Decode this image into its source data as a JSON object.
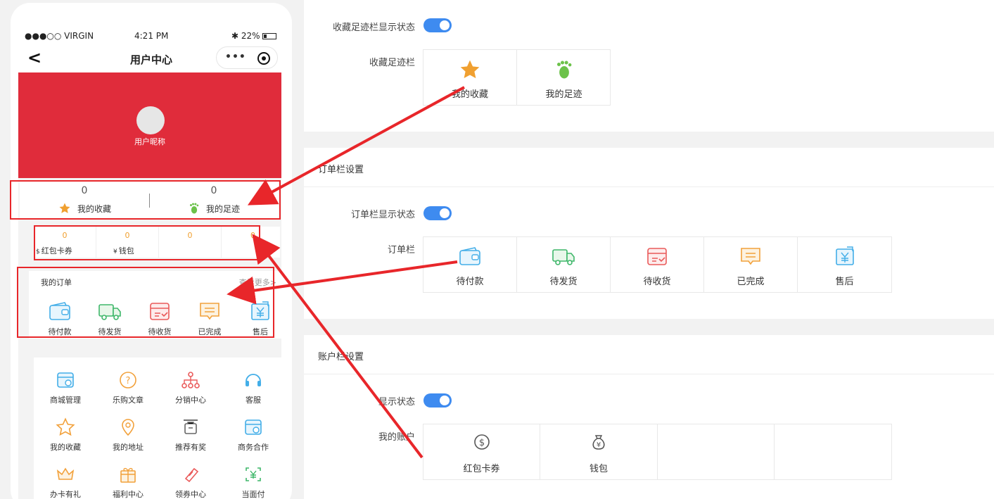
{
  "phone": {
    "status": {
      "carrier": "●●●○○ VIRGIN",
      "time": "4:21 PM",
      "battery": "22%"
    },
    "nav_title": "用户中心",
    "nav_dots": "•••",
    "nickname": "用户昵称",
    "favorites": [
      {
        "count": "0",
        "label": "我的收藏"
      },
      {
        "count": "0",
        "label": "我的足迹"
      }
    ],
    "account": [
      {
        "value": "0",
        "label": "红包卡券",
        "glyph": "$"
      },
      {
        "value": "0",
        "label": "钱包",
        "glyph": "¥"
      },
      {
        "value": "0",
        "label": ""
      },
      {
        "value": "0",
        "label": ""
      }
    ],
    "orders": {
      "title": "我的订单",
      "more": "查看更多>",
      "items": [
        {
          "label": "待付款",
          "icon": "wallet-icon"
        },
        {
          "label": "待发货",
          "icon": "truck-icon"
        },
        {
          "label": "待收货",
          "icon": "box-icon"
        },
        {
          "label": "已完成",
          "icon": "message-icon"
        },
        {
          "label": "售后",
          "icon": "refund-icon"
        }
      ]
    },
    "menu": [
      {
        "label": "商城管理",
        "icon": "store-icon"
      },
      {
        "label": "乐购文章",
        "icon": "question-icon"
      },
      {
        "label": "分销中心",
        "icon": "network-icon"
      },
      {
        "label": "客服",
        "icon": "headset-icon"
      },
      {
        "label": "我的收藏",
        "icon": "star-outline-icon"
      },
      {
        "label": "我的地址",
        "icon": "location-icon"
      },
      {
        "label": "推荐有奖",
        "icon": "gift-cart-icon"
      },
      {
        "label": "商务合作",
        "icon": "handshake-icon"
      },
      {
        "label": "办卡有礼",
        "icon": "crown-icon"
      },
      {
        "label": "福利中心",
        "icon": "gift-icon"
      },
      {
        "label": "领券中心",
        "icon": "ticket-icon"
      },
      {
        "label": "当面付",
        "icon": "scan-pay-icon"
      }
    ]
  },
  "settings": {
    "favorites": {
      "status_label": "收藏足迹栏显示状态",
      "bar_label": "收藏足迹栏",
      "items": [
        {
          "label": "我的收藏",
          "icon": "star-icon"
        },
        {
          "label": "我的足迹",
          "icon": "footprint-icon"
        }
      ]
    },
    "orders": {
      "title": "订单栏设置",
      "status_label": "订单栏显示状态",
      "bar_label": "订单栏",
      "items": [
        {
          "label": "待付款",
          "icon": "wallet-icon"
        },
        {
          "label": "待发货",
          "icon": "truck-icon"
        },
        {
          "label": "待收货",
          "icon": "box-icon"
        },
        {
          "label": "已完成",
          "icon": "message-icon"
        },
        {
          "label": "售后",
          "icon": "refund-icon"
        }
      ]
    },
    "account": {
      "title": "账户栏设置",
      "status_label": "显示状态",
      "bar_label": "我的账户",
      "items": [
        {
          "label": "红包卡券",
          "icon": "dollar-circle-icon"
        },
        {
          "label": "钱包",
          "icon": "money-bag-icon"
        },
        {
          "label": ""
        },
        {
          "label": ""
        }
      ]
    }
  },
  "colors": {
    "banner": "#e02c3b",
    "toggle": "#3e8bf0",
    "highlight": "#e8262a",
    "accent_value": "#f0a030"
  }
}
